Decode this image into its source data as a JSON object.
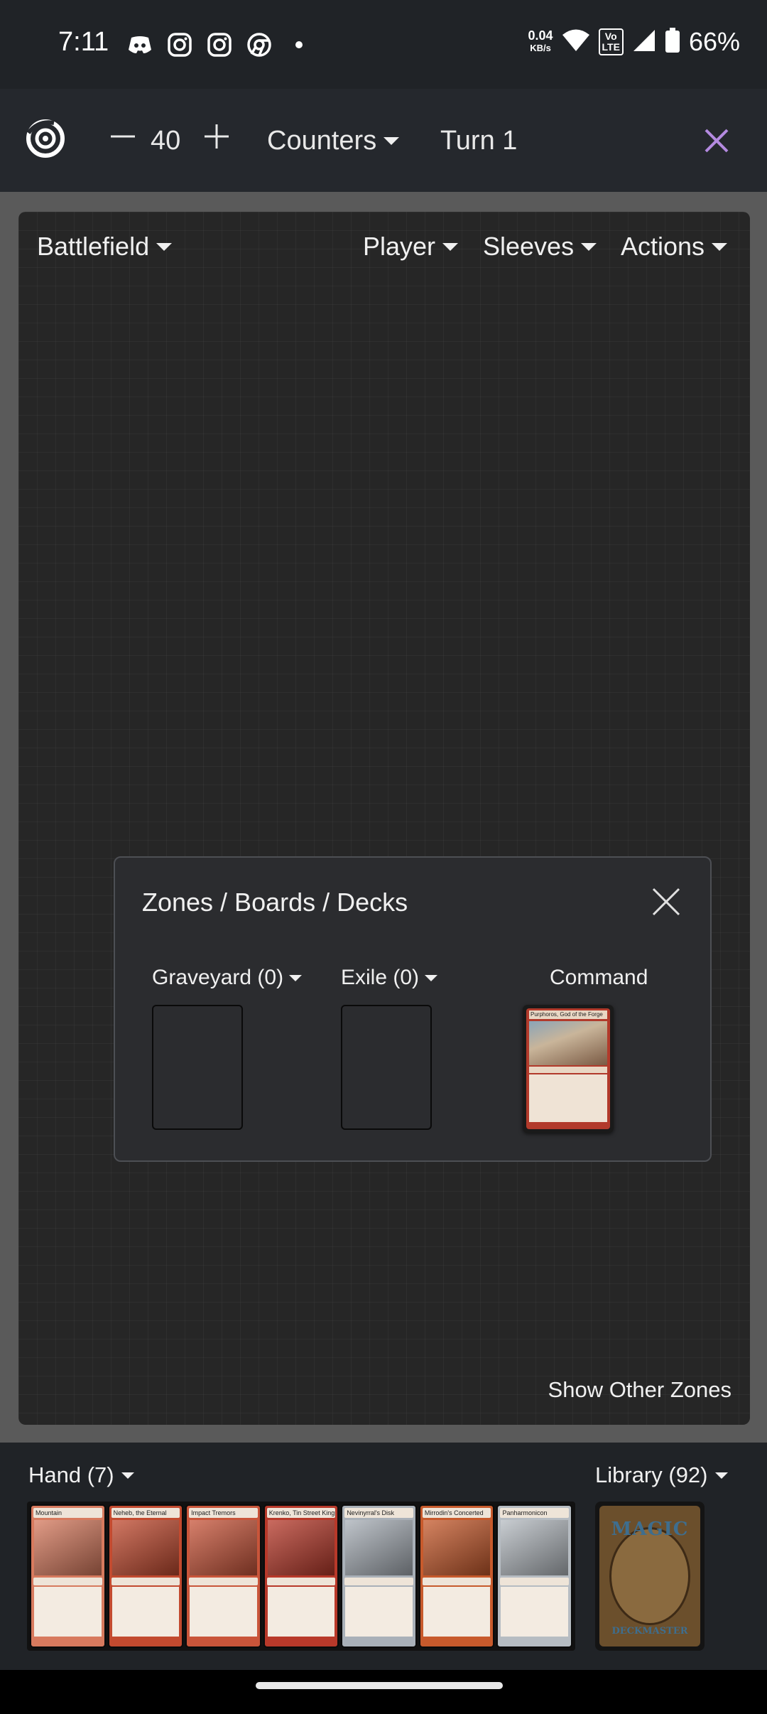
{
  "status_bar": {
    "time": "7:11",
    "app_icons": [
      "discord-icon",
      "instagram-icon",
      "instagram-icon",
      "chrome-icon",
      "dot-icon"
    ],
    "net_speed_value": "0.04",
    "net_speed_unit": "KB/s",
    "volte_top": "Vo",
    "volte_bottom": "LTE",
    "battery": "66%"
  },
  "toolbar": {
    "life": "40",
    "counters_label": "Counters",
    "turn_label": "Turn 1",
    "accent": "#b48ae0"
  },
  "battlefield": {
    "zone_label": "Battlefield",
    "player_label": "Player",
    "sleeves_label": "Sleeves",
    "actions_label": "Actions"
  },
  "zones_panel": {
    "title": "Zones / Boards / Decks",
    "graveyard_label": "Graveyard (0)",
    "exile_label": "Exile (0)",
    "command_label": "Command",
    "command_card_name": "Purphoros, God of the Forge",
    "show_other_label": "Show Other Zones"
  },
  "hand": {
    "label": "Hand (7)",
    "cards": [
      {
        "name": "Mountain",
        "color": "#d77a5e"
      },
      {
        "name": "Neheb, the Eternal",
        "color": "#c24a2f"
      },
      {
        "name": "Impact Tremors",
        "color": "#c9553a"
      },
      {
        "name": "Krenko, Tin Street Kingpin",
        "color": "#b8392a"
      },
      {
        "name": "Nevinyrral's Disk",
        "color": "#a9b0b8"
      },
      {
        "name": "Mirrodin's Concerted",
        "color": "#c75a2c"
      },
      {
        "name": "Panharmonicon",
        "color": "#b6bcc2"
      }
    ]
  },
  "library": {
    "label": "Library (92)",
    "card_back_title": "MAGIC",
    "card_back_sub": "DECKMASTER"
  }
}
